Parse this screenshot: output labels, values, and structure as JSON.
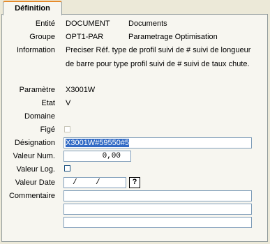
{
  "tab": {
    "label": "Définition"
  },
  "entite": {
    "label": "Entité",
    "code": "DOCUMENT",
    "name": "Documents"
  },
  "groupe": {
    "label": "Groupe",
    "code": "OPT1-PAR",
    "name": "Parametrage Optimisation"
  },
  "information": {
    "label": "Information",
    "line1": "Preciser Réf. type de profil suivi de # suivi de longueur",
    "line2": "de barre pour type profil suivi de # suivi de taux chute."
  },
  "parametre": {
    "label": "Paramètre",
    "value": "X3001W"
  },
  "etat": {
    "label": "Etat",
    "value": "V"
  },
  "domaine": {
    "label": "Domaine",
    "value": ""
  },
  "fige": {
    "label": "Figé",
    "checked": false
  },
  "designation": {
    "label": "Désignation",
    "value": "X3001W#59550#5"
  },
  "valeur_num": {
    "label": "Valeur Num.",
    "value": "0,00"
  },
  "valeur_log": {
    "label": "Valeur Log.",
    "checked": false
  },
  "valeur_date": {
    "label": "Valeur Date",
    "value": "/    /",
    "help_label": "?"
  },
  "commentaire": {
    "label": "Commentaire",
    "lines": [
      "",
      "",
      ""
    ]
  }
}
